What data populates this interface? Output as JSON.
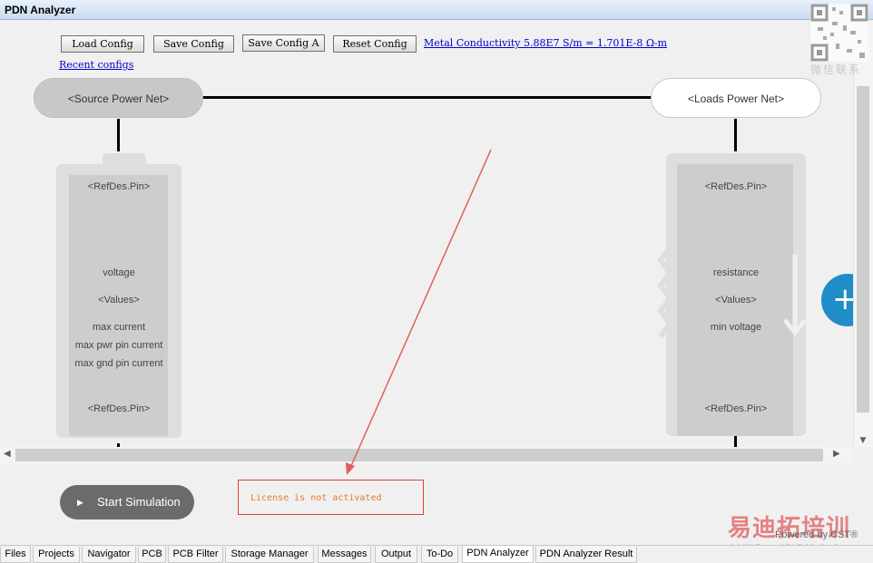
{
  "window": {
    "title": "PDN Analyzer",
    "controls": [
      "▾",
      "⊼",
      "✕"
    ]
  },
  "toolbar": {
    "load_config": "Load Config",
    "save_config": "Save Config",
    "save_config_a": "Save Config A",
    "reset_config": "Reset Config",
    "metal_conductivity": "Metal Conductivity 5.88E7 S/m = 1.701E-8 Ω-m",
    "recent_configs": "Recent configs"
  },
  "source_net": {
    "label": "<Source Power Net>",
    "card": {
      "top_pin": "<RefDes.Pin>",
      "voltage": "voltage",
      "values": "<Values>",
      "max_current": "max current",
      "max_pwr_pin_current": "max pwr pin current",
      "max_gnd_pin_current": "max gnd pin current",
      "bottom_pin": "<RefDes.Pin>"
    }
  },
  "loads_net": {
    "label": "<Loads Power Net>",
    "card": {
      "top_pin": "<RefDes.Pin>",
      "resistance": "resistance",
      "values": "<Values>",
      "min_voltage": "min voltage",
      "bottom_pin": "<RefDes.Pin>"
    }
  },
  "add_button": {
    "icon": "plus-icon",
    "color": "#1f8dc7"
  },
  "simulation": {
    "start_label": "Start Simulation"
  },
  "license": {
    "message": "License is not activated"
  },
  "tabs": [
    {
      "label": "Files",
      "active": false
    },
    {
      "label": "Projects",
      "active": false
    },
    {
      "label": "Navigator",
      "active": false
    },
    {
      "label": "PCB",
      "active": false
    },
    {
      "label": "PCB Filter",
      "active": false
    },
    {
      "label": "Storage Manager",
      "active": false
    },
    {
      "label": "Messages",
      "active": false
    },
    {
      "label": "Output",
      "active": false
    },
    {
      "label": "To-Do",
      "active": false
    },
    {
      "label": "PDN Analyzer",
      "active": true
    },
    {
      "label": "PDN Analyzer Result",
      "active": false
    }
  ],
  "watermark": {
    "wechat": "微信联系",
    "brand": "易迪拓培训",
    "tagline": "射频和天线设计专家",
    "powered": "Powered by CST®"
  },
  "colors": {
    "accent": "#1f8dc7",
    "annotation": "#e0403a",
    "license_text": "#e87a30"
  }
}
